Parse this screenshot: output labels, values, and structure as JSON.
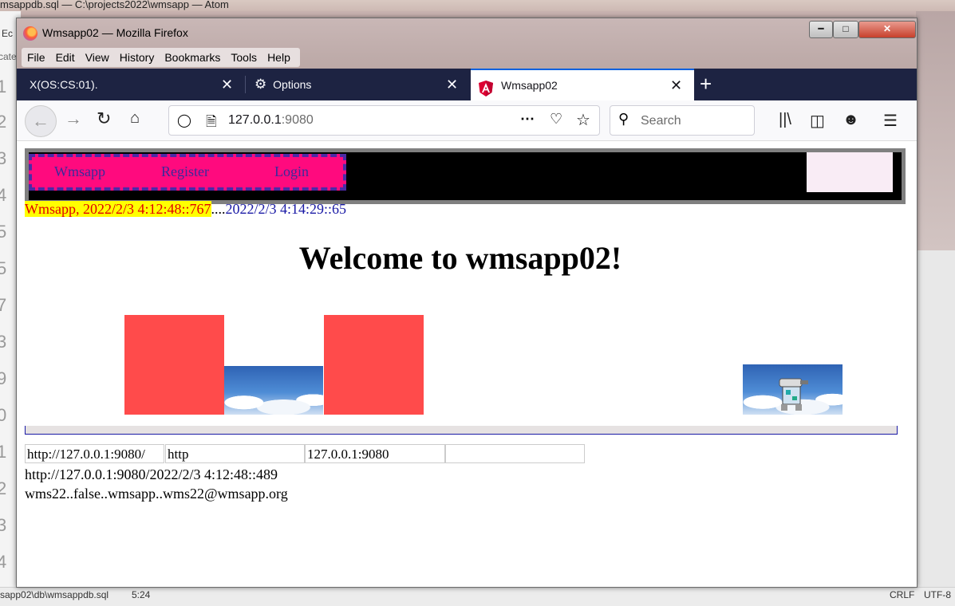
{
  "atom": {
    "title": "msappdb.sql — C:\\projects2022\\wmsapp — Atom",
    "side_tab1": "Ec",
    "side_tab2": "cate",
    "line_numbers": [
      "1",
      "2",
      "3",
      "4",
      "5",
      "5",
      "7",
      "3",
      "9",
      "0",
      "1",
      "2",
      "3",
      "4"
    ],
    "status_path": "sapp02\\db\\wmsappdb.sql",
    "status_cursor": "5:24",
    "status_eol": "CRLF",
    "status_encoding": "UTF-8"
  },
  "firefox": {
    "window_title": "Wmsapp02 — Mozilla Firefox",
    "menu": [
      "File",
      "Edit",
      "View",
      "History",
      "Bookmarks",
      "Tools",
      "Help"
    ],
    "tabs": [
      {
        "label": "X(OS:CS:01).",
        "active": false
      },
      {
        "label": "Options",
        "active": false
      },
      {
        "label": "Wmsapp02",
        "active": true
      }
    ],
    "url_host": "127.0.0.1",
    "url_port": ":9080",
    "search_placeholder": "Search"
  },
  "page": {
    "nav_items": [
      "Wmsapp",
      "Register",
      "Login"
    ],
    "timeline_highlight": "Wmsapp, 2022/2/3 4:12:48::767",
    "timeline_dots": "....",
    "timeline_time2": "2022/2/3 4:14:29::65",
    "welcome": "Welcome to wmsapp02!",
    "fields": [
      "http://127.0.0.1:9080/",
      "http",
      "127.0.0.1:9080",
      ""
    ],
    "line1": "http://127.0.0.1:9080/2022/2/3 4:12:48::489",
    "line2": "wms22..false..wmsapp..wms22@wmsapp.org"
  },
  "colors": {
    "tabbar_bg": "#1d2342",
    "nav_menu_bg": "#ff0a7e",
    "nav_dash": "#4c2aa5",
    "highlight_bg": "#ffff00",
    "highlight_text": "#e00000",
    "red_block": "#ff4b4b"
  }
}
